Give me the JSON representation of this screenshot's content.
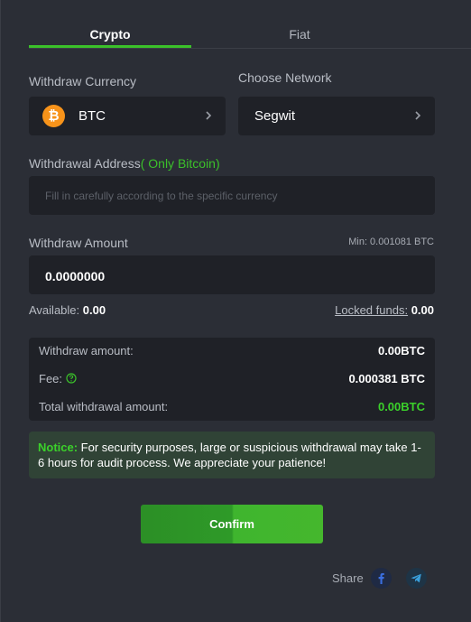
{
  "tabs": {
    "crypto": "Crypto",
    "fiat": "Fiat"
  },
  "currency": {
    "label": "Withdraw Currency",
    "value": "BTC",
    "coin_symbol": "₿"
  },
  "network": {
    "label": "Choose Network",
    "value": "Segwit"
  },
  "address": {
    "label": "Withdrawal Address",
    "note": "( Only Bitcoin)",
    "placeholder": "Fill in carefully according to the specific currency"
  },
  "amount": {
    "label": "Withdraw Amount",
    "min": "Min: 0.001081 BTC",
    "value": "0.0000000",
    "available_label": "Available:",
    "available_value": "0.00",
    "locked_label": "Locked funds:",
    "locked_value": "0.00"
  },
  "summary": {
    "withdraw_label": "Withdraw amount:",
    "withdraw_value": "0.00BTC",
    "fee_label": "Fee:",
    "fee_value": "0.000381 BTC",
    "total_label": "Total withdrawal amount:",
    "total_value": "0.00BTC"
  },
  "notice": {
    "tag": "Notice:",
    "text": " For security purposes, large or suspicious withdrawal may take 1-6 hours for audit process. We appreciate your patience!"
  },
  "confirm_label": "Confirm",
  "share": {
    "label": "Share",
    "icons": [
      "facebook-icon",
      "telegram-icon"
    ]
  },
  "colors": {
    "accent": "#3bc12a",
    "background": "#2b2e36",
    "field": "#1f2127"
  }
}
